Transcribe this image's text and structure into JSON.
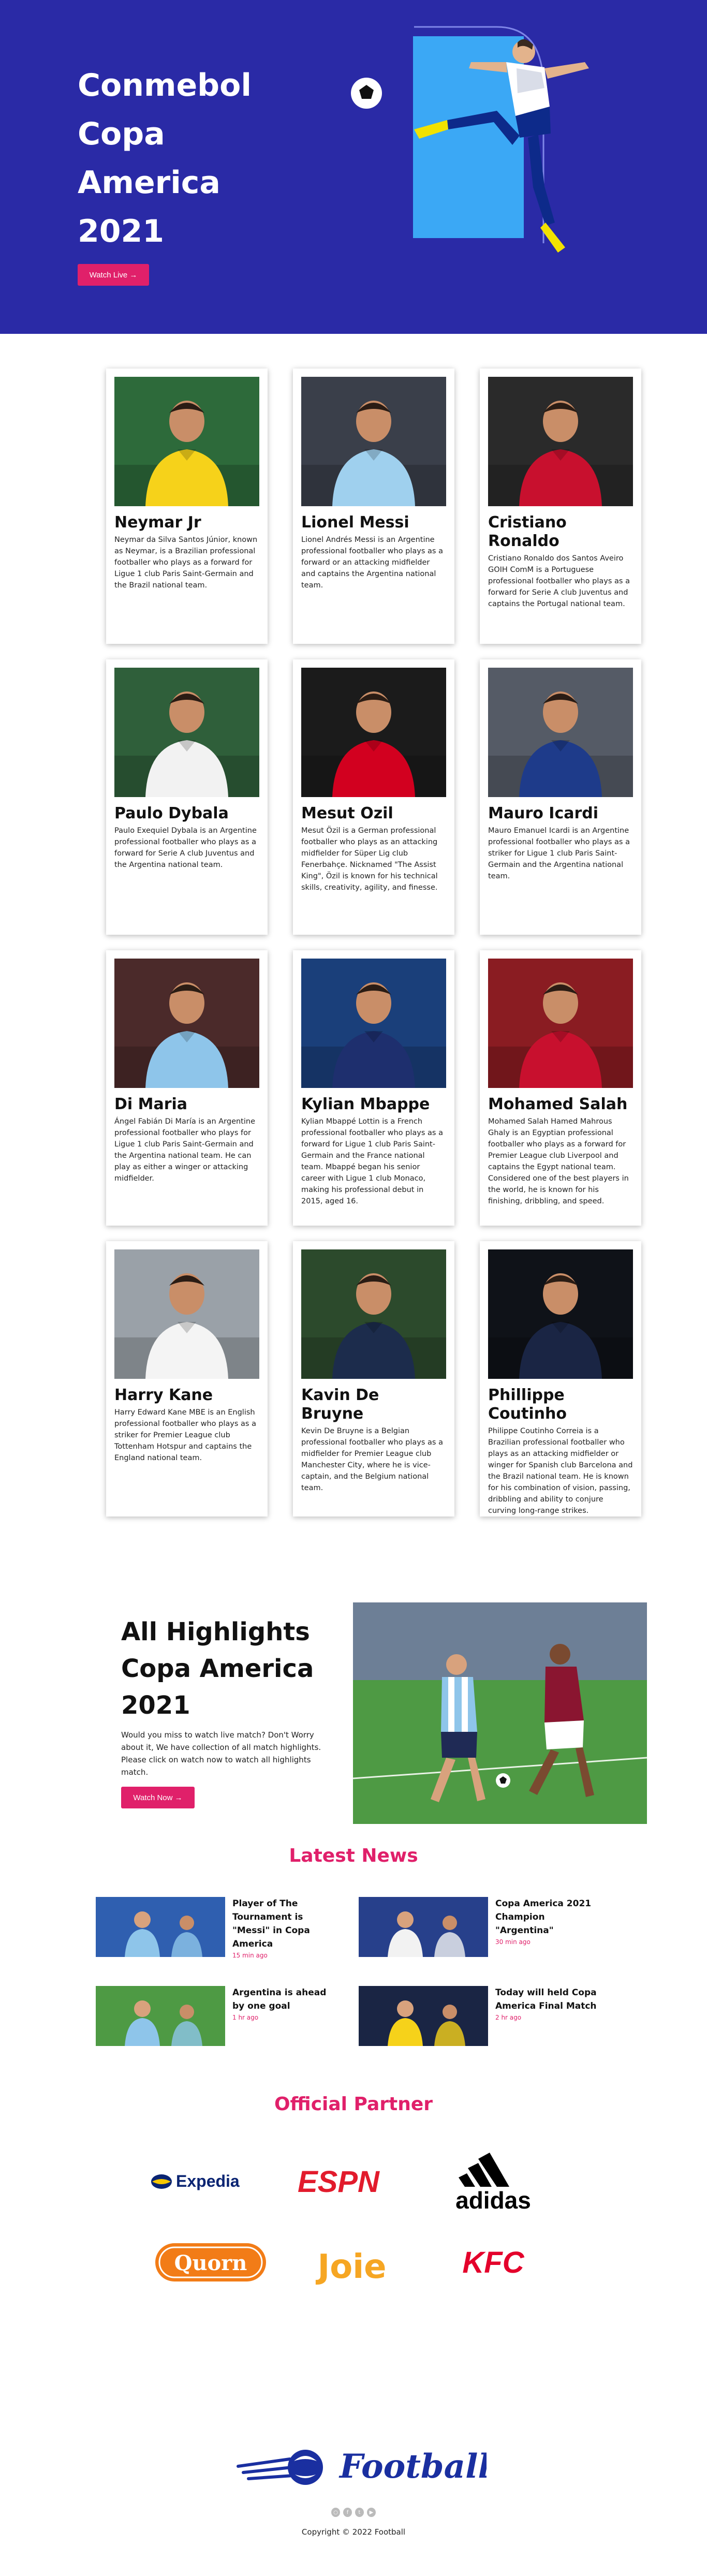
{
  "hero": {
    "title": "Conmebol Copa America 2021",
    "button_label": "Watch Live →"
  },
  "players": [
    {
      "name": "Neymar Jr",
      "desc": "Neymar da Silva Santos Júnior, known as Neymar, is a Brazilian professional footballer who plays as a forward for Ligue 1 club Paris Saint-Germain and the Brazil national team.",
      "jersey": "#f6d21a",
      "shorts": "#1a4fa0",
      "bg": "#2d6a3a"
    },
    {
      "name": "Lionel Messi",
      "desc": "Lionel Andrés Messi is an Argentine professional footballer who plays as a forward or an attacking midfielder and captains the Argentina national team.",
      "jersey": "#9fd0ee",
      "shorts": "#1f2a55",
      "bg": "#3a3f4a"
    },
    {
      "name": "Cristiano Ronaldo",
      "desc": "Cristiano Ronaldo dos Santos Aveiro GOIH ComM is a Portuguese professional footballer who plays as a forward for Serie A club Juventus and captains the Portugal national team.",
      "jersey": "#c8102e",
      "shorts": "#1d5a2c",
      "bg": "#2a2a2a"
    },
    {
      "name": "Paulo Dybala",
      "desc": "Paulo Exequiel Dybala is an Argentine professional footballer who plays as a forward for Serie A club Juventus and the Argentina national team.",
      "jersey": "#f2f2f2",
      "shorts": "#111111",
      "bg": "#2f5f3a"
    },
    {
      "name": "Mesut Ozil",
      "desc": "Mesut Özil is a German professional footballer who plays as an attacking midfielder for Süper Lig club Fenerbahçe. Nicknamed \"The Assist King\", Özil is known for his technical skills, creativity, agility, and finesse.",
      "jersey": "#d2001f",
      "shorts": "#ffffff",
      "bg": "#1b1b1b"
    },
    {
      "name": "Mauro Icardi",
      "desc": "Mauro Emanuel Icardi is an Argentine professional footballer who plays as a striker for Ligue 1 club Paris Saint-Germain and the Argentina national team.",
      "jersey": "#1e3b8a",
      "shorts": "#111111",
      "bg": "#555b66"
    },
    {
      "name": "Di Maria",
      "desc": "Ángel Fabián Di María is an Argentine professional footballer who plays for Ligue 1 club Paris Saint-Germain and the Argentina national team. He can play as either a winger or attacking midfielder.",
      "jersey": "#8ec5ea",
      "shorts": "#1f2a55",
      "bg": "#4b2a2a"
    },
    {
      "name": "Kylian Mbappe",
      "desc": "Kylian Mbappé Lottin is a French professional footballer who plays as a forward for Ligue 1 club Paris Saint-Germain and the France national team. Mbappé began his senior career with Ligue 1 club Monaco, making his professional debut in 2015, aged 16.",
      "jersey": "#1e2f6e",
      "shorts": "#ffffff",
      "bg": "#1a3f7a"
    },
    {
      "name": "Mohamed Salah",
      "desc": "Mohamed Salah Hamed Mahrous Ghaly is an Egyptian professional footballer who plays as a forward for Premier League club Liverpool and captains the Egypt national team. Considered one of the best players in the world, he is known for his finishing, dribbling, and speed.",
      "jersey": "#c8102e",
      "shorts": "#c8102e",
      "bg": "#8a1c22"
    },
    {
      "name": "Harry Kane",
      "desc": "Harry Edward Kane MBE is an English professional footballer who plays as a striker for Premier League club Tottenham Hotspur and captains the England national team.",
      "jersey": "#f4f4f4",
      "shorts": "#1a2a5a",
      "bg": "#9aa1a8"
    },
    {
      "name": "Kavin De Bruyne",
      "desc": "Kevin De Bruyne is a Belgian professional footballer who plays as a midfielder for Premier League club Manchester City, where he is vice-captain, and the Belgium national team.",
      "jersey": "#1c2c4c",
      "shorts": "#1c2c4c",
      "bg": "#2c4a2c"
    },
    {
      "name": "Phillippe Coutinho",
      "desc": "Philippe Coutinho Correia is a Brazilian professional footballer who plays as an attacking midfielder or winger for Spanish club Barcelona and the Brazil national team. He is known for his combination of vision, passing, dribbling and ability to conjure curving long-range strikes.",
      "jersey": "#1a2544",
      "shorts": "#1a2544",
      "bg": "#0f1218"
    }
  ],
  "highlights": {
    "title": "All Highlights Copa America 2021",
    "text": "Would you miss to watch live match? Don't Worry about it, We have collection of all match highlights. Please click on watch now to watch all highlights match.",
    "button_label": "Watch Now →"
  },
  "news": {
    "heading": "Latest News",
    "items": [
      {
        "title": "Player of The Tournament is \"Messi\" in Copa America",
        "time": "15 min ago"
      },
      {
        "title": "Copa America 2021 Champion \"Argentina\"",
        "time": "30 min ago"
      },
      {
        "title": "Argentina is ahead by one goal",
        "time": "1 hr ago"
      },
      {
        "title": "Today will held Copa America Final Match",
        "time": "2 hr ago"
      }
    ]
  },
  "partners": {
    "heading": "Official Partner",
    "logos": [
      {
        "name": "Expedia",
        "color": "#0a2472"
      },
      {
        "name": "ESPN",
        "color": "#e21b2c"
      },
      {
        "name": "adidas",
        "color": "#000000"
      },
      {
        "name": "Quorn",
        "color": "#f27c17"
      },
      {
        "name": "Joie",
        "color": "#f6a623"
      },
      {
        "name": "KFC",
        "color": "#e4002b"
      }
    ]
  },
  "footer": {
    "brand": "Football",
    "copyright": "Copyright © 2022 Football",
    "socials": [
      "instagram-icon",
      "facebook-icon",
      "twitter-icon",
      "youtube-icon"
    ]
  },
  "colors": {
    "hero_bg": "#2a2aa6",
    "accent_pink": "#e0206a",
    "hero_frame": "#3ba8f5"
  }
}
